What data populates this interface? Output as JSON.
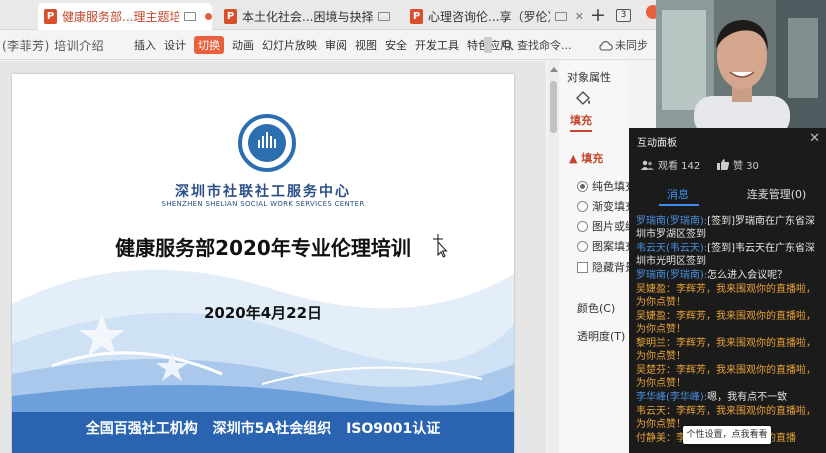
{
  "tabs": [
    {
      "label": "健康服务部...理主题培训",
      "active": true
    },
    {
      "label": "本土化社会...困境与抉择",
      "active": false
    },
    {
      "label": "心理咨询伦...享（罗伦）",
      "active": false
    }
  ],
  "tab_count_badge": "3",
  "document_title": "(李菲芳) 培训介绍",
  "menu": [
    "插入",
    "设计",
    "切换",
    "动画",
    "幻灯片放映",
    "审阅",
    "视图",
    "安全",
    "开发工具",
    "特色应用"
  ],
  "menu_selected": "切换",
  "search_label": "查找命令...",
  "sync_label": "未同步",
  "slide": {
    "org_cn": "深圳市社联社工服务中心",
    "org_en": "SHENZHEN SHELIAN SOCIAL WORK SERVICES CENTER",
    "title": "健康服务部2020年专业伦理培训",
    "date": "2020年4月22日",
    "bottom": "全国百强社工机构  深圳市5A社会组织  ISO9001认证"
  },
  "props": {
    "title": "对象属性",
    "fill_tab": "填充",
    "section": "填充",
    "options": [
      "纯色填充",
      "渐变填充",
      "图片或纹理填充",
      "图案填充"
    ],
    "checkbox": "隐藏背景图形",
    "color_label": "颜色(C)",
    "transparency_label": "透明度(T)"
  },
  "chat": {
    "title": "互动面板",
    "viewers_label": "观看 142",
    "likes_label": "赞 30",
    "tab_messages": "消息",
    "tab_mic": "连麦管理(0)",
    "messages": [
      {
        "name": "罗瑞南(罗瑞南):",
        "text": "[签到]罗瑞南在广东省深圳市罗湖区签到",
        "gift": false
      },
      {
        "name": "韦云天(韦云天):",
        "text": "[签到]韦云天在广东省深圳市光明区签到",
        "gift": false
      },
      {
        "name": "罗瑞南(罗瑞南):",
        "text": "怎么进入会议呢？",
        "gift": false
      },
      {
        "name": "吴婕盈：",
        "text": "李辉芳，我来围观你的直播啦，为你点赞！",
        "gift": true
      },
      {
        "name": "吴婕盈：",
        "text": "李辉芳，我来围观你的直播啦，为你点赞！",
        "gift": true
      },
      {
        "name": "黎明兰：",
        "text": "李辉芳，我来围观你的直播啦，为你点赞！",
        "gift": true
      },
      {
        "name": "吴楚芬：",
        "text": "李辉芳，我来围观你的直播啦，为你点赞！",
        "gift": true
      },
      {
        "name": "李华峰(李华峰):",
        "text": "嗯，我有点不一致",
        "gift": false
      },
      {
        "name": "韦云天：",
        "text": "李辉芳，我来围观你的直播啦，为你点赞！",
        "gift": true
      },
      {
        "name": "付静美：",
        "text": "李辉芳，我来围观你的直播",
        "gift": true
      }
    ],
    "tooltip": "个性设置，点我看看"
  }
}
